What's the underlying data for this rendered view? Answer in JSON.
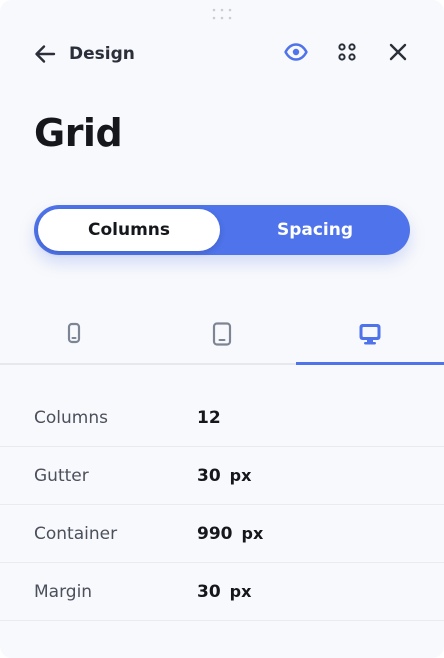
{
  "header": {
    "back_label": "Design",
    "icons": [
      "arrow-left-icon",
      "eye-icon",
      "dots-grid-icon",
      "close-icon"
    ]
  },
  "page_title": "Grid",
  "segmented": {
    "options": [
      {
        "label": "Columns",
        "selected": true
      },
      {
        "label": "Spacing",
        "selected": false
      }
    ]
  },
  "device_tabs": [
    {
      "icon": "phone-icon",
      "selected": false
    },
    {
      "icon": "tablet-icon",
      "selected": false
    },
    {
      "icon": "desktop-icon",
      "selected": true
    }
  ],
  "properties": [
    {
      "label": "Columns",
      "value": "12",
      "unit": ""
    },
    {
      "label": "Gutter",
      "value": "30",
      "unit": "px"
    },
    {
      "label": "Container",
      "value": "990",
      "unit": "px"
    },
    {
      "label": "Margin",
      "value": "30",
      "unit": "px"
    }
  ],
  "colors": {
    "accent": "#4e73ea",
    "background": "#f8f9fc",
    "text_primary": "#15171c",
    "text_secondary": "#4b505c",
    "icon_muted": "#7d8594"
  }
}
